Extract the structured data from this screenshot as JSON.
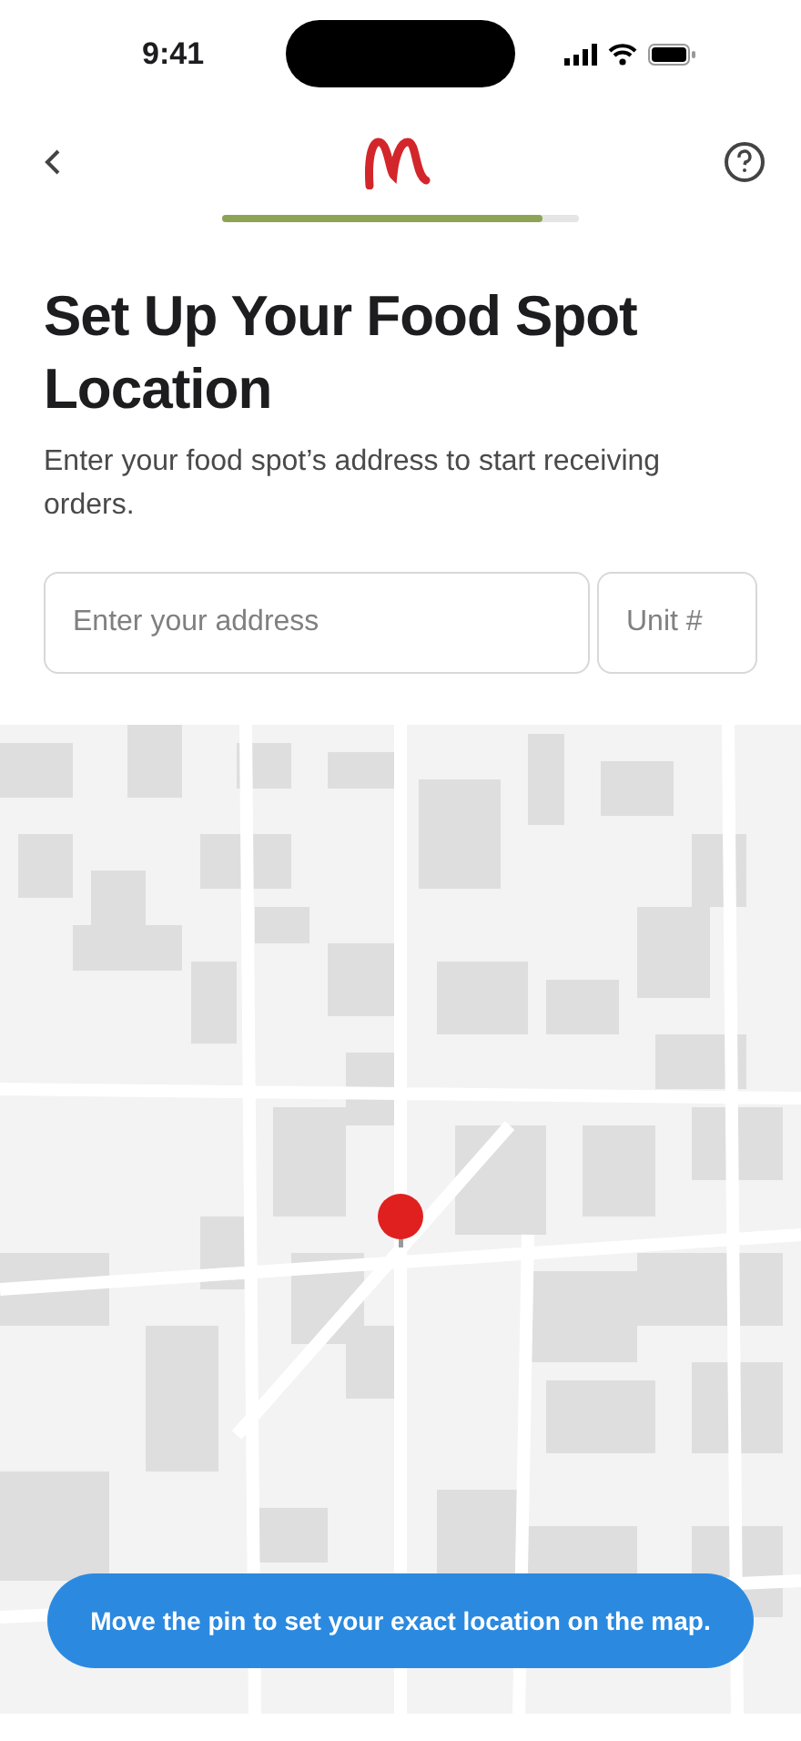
{
  "status_bar": {
    "time": "9:41"
  },
  "progress": {
    "level": 0.9
  },
  "title": "Set Up Your Food Spot Location",
  "subtitle": "Enter your food spot’s address to start receiving orders.",
  "address_field": {
    "placeholder": "Enter your address"
  },
  "unit_field": {
    "placeholder": "Unit #"
  },
  "map": {
    "kind": "picture",
    "hint": "Move the pin to set your exact location on the map."
  }
}
